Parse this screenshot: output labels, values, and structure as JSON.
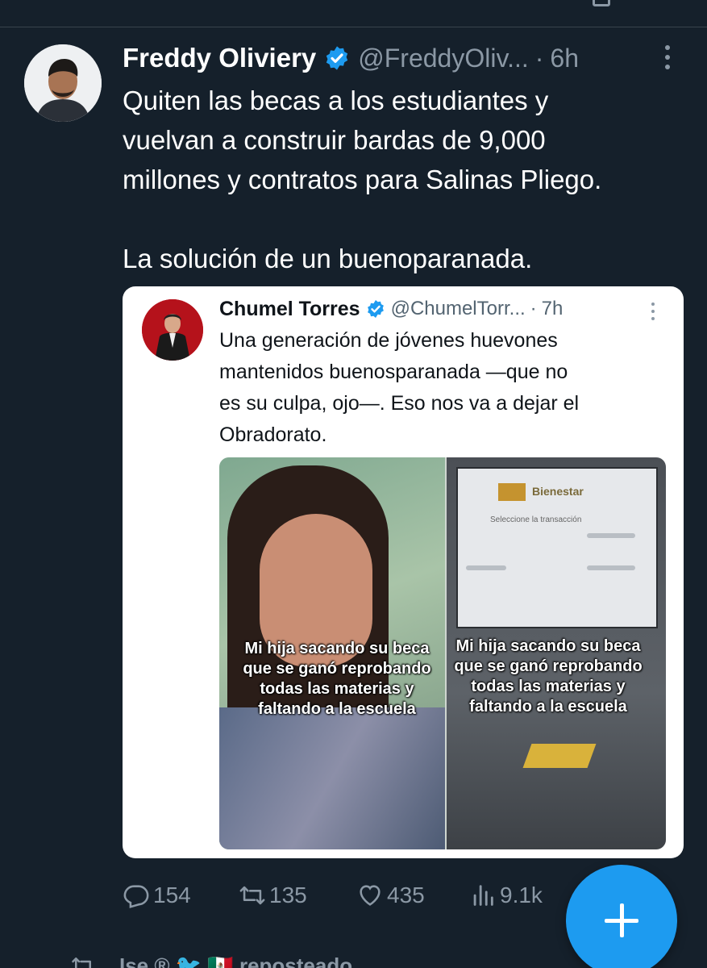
{
  "tweet": {
    "author_name": "Freddy Oliviery",
    "handle": "@FreddyOliv...",
    "separator": "·",
    "time": "6h",
    "text_lines": [
      "Quiten las becas a los estudiantes y",
      "vuelvan a construir bardas de 9,000",
      "millones y contratos para Salinas Pliego.",
      "",
      "La solución de un buenoparanada."
    ]
  },
  "quoted_tweet": {
    "author_name": "Chumel Torres",
    "handle": "@ChumelTorr...",
    "separator": "·",
    "time": "7h",
    "text_lines": [
      "Una generación de jóvenes huevones",
      "mantenidos buenosparanada —que no",
      "es su culpa, ojo—. Eso nos va a dejar el",
      "Obradorato."
    ],
    "image": {
      "caption_left": [
        "Mi hija sacando su beca",
        "que se ganó reprobando",
        "todas las materias y",
        "faltando a la escuela"
      ],
      "caption_right": [
        "Mi hija sacando su beca",
        "que se ganó reprobando",
        "todas las materias y",
        "faltando a la escuela"
      ],
      "atm_brand": "Bienestar",
      "atm_prompt": "Seleccione la transacción"
    }
  },
  "actions": {
    "replies": "154",
    "retweets": "135",
    "likes": "435",
    "views": "9.1k"
  },
  "next_item": {
    "text": "Ise ® 🐦 🇲🇽 reposteado"
  },
  "colors": {
    "background": "#15202b",
    "accent": "#1d9bf0",
    "secondary_text": "#8b98a5",
    "verified": "#1d9bf0"
  }
}
